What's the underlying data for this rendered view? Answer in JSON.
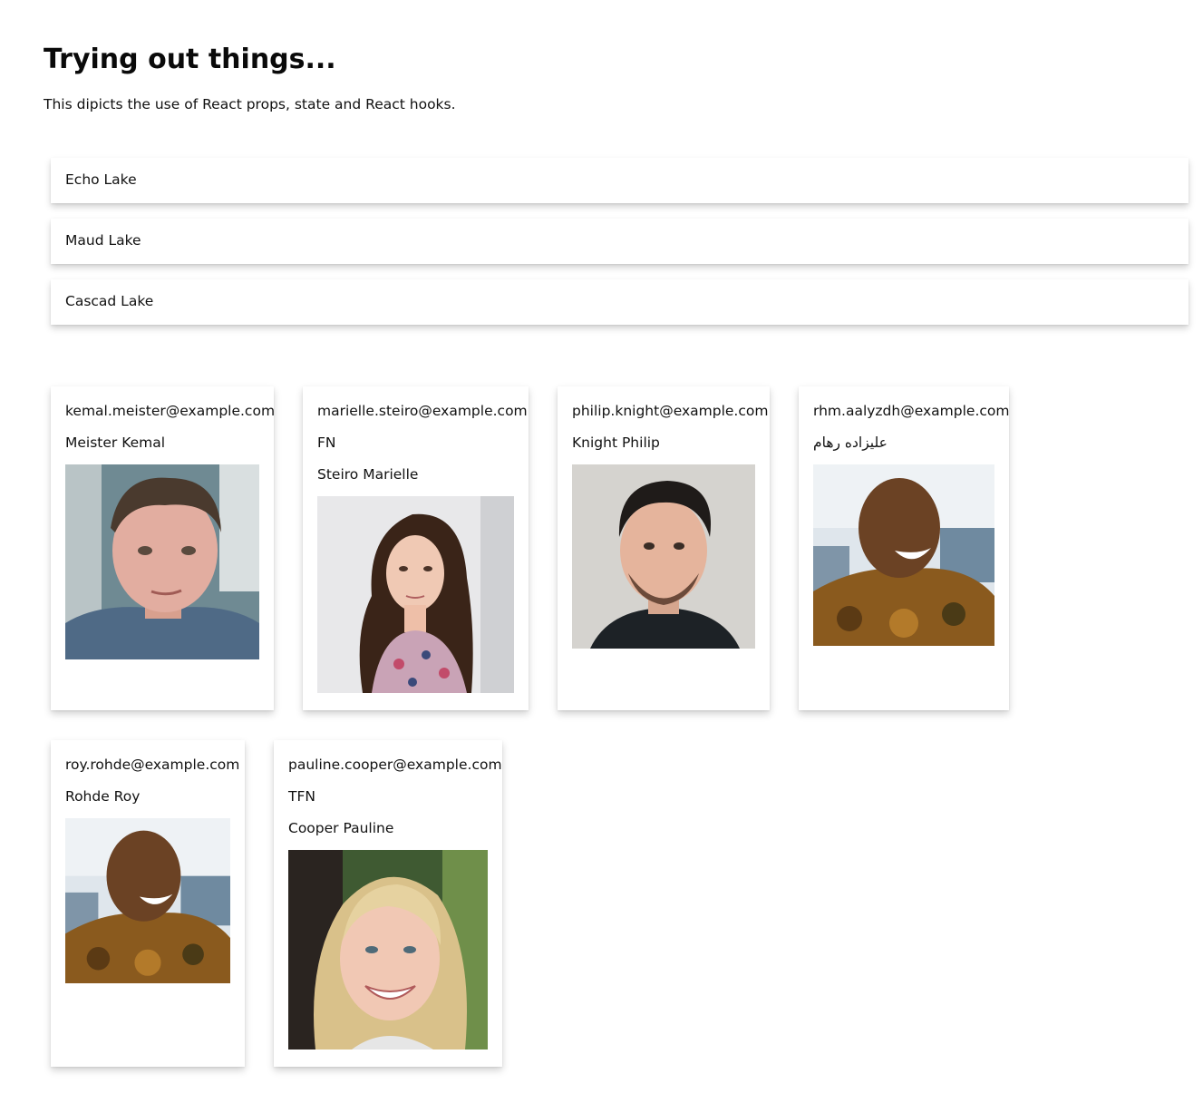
{
  "header": {
    "title": "Trying out things...",
    "subtitle": "This dipicts the use of React props, state and React hooks."
  },
  "lakes": [
    {
      "name": "Echo Lake"
    },
    {
      "name": "Maud Lake"
    },
    {
      "name": "Cascad Lake"
    }
  ],
  "users": [
    {
      "email": "kemal.meister@example.com",
      "name": "Meister Kemal",
      "photo_icon": "person-photo"
    },
    {
      "email": "marielle.steiro@example.com",
      "tag": "FN",
      "name": "Steiro Marielle",
      "photo_icon": "person-photo"
    },
    {
      "email": "philip.knight@example.com",
      "name": "Knight Philip",
      "photo_icon": "person-photo"
    },
    {
      "email": "rhm.aalyzdh@example.com",
      "name": "علیزاده رهام",
      "photo_icon": "person-photo"
    },
    {
      "email": "roy.rohde@example.com",
      "name": "Rohde Roy",
      "photo_icon": "person-photo"
    },
    {
      "email": "pauline.cooper@example.com",
      "tag": "TFN",
      "name": "Cooper Pauline",
      "photo_icon": "person-photo"
    }
  ]
}
